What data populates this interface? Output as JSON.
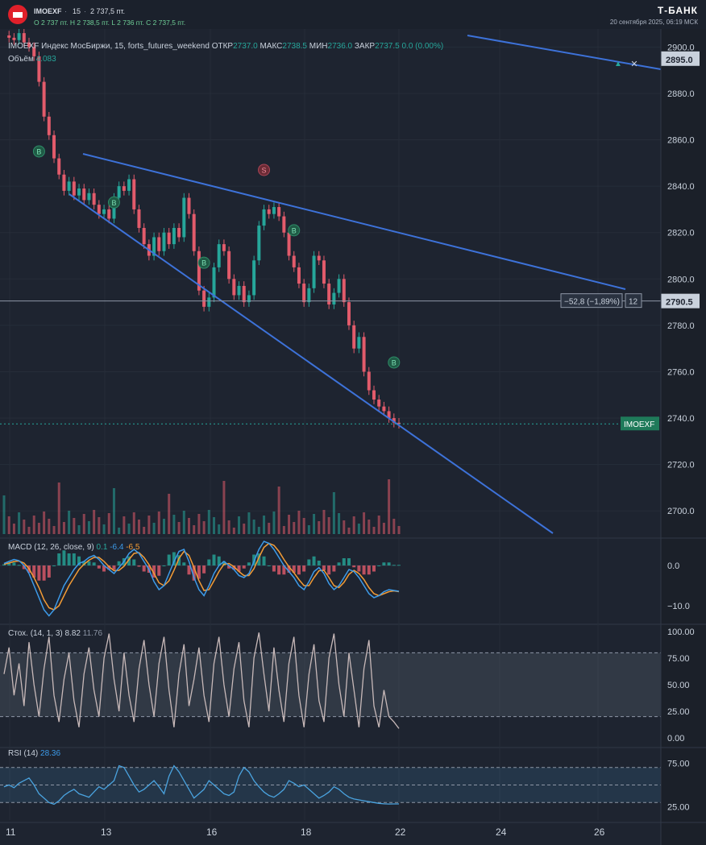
{
  "header": {
    "symbol": "IMOEXF",
    "sep": "·",
    "timeframe": "15",
    "sep2": "·",
    "last_price": "2 737,5 пт.",
    "ohlc": "O 2 737 пт.   H 2 738,5 пт.   L 2 736 пт.   C 2 737,5 пт.",
    "brand": "Т-БАНК",
    "datetime": "20 сентября 2025, 06:19 МСК"
  },
  "legend": {
    "symbol": "IMOEXF",
    "description": "Индекс МосБиржи, 15, forts_futures_weekend",
    "open_label": "ОТКР",
    "open": "2737.0",
    "high_label": "МАКС",
    "high": "2738.5",
    "low_label": "МИН",
    "low": "2736.0",
    "close_label": "ЗАКР",
    "close": "2737.5",
    "change": "0.0 (0.00%)",
    "volume_label": "Объём",
    "volume": "4.083"
  },
  "macd_legend": {
    "title": "MACD (12, 26, close, 9)",
    "hist": "0.1",
    "macd": "-6.4",
    "signal": "-6.5"
  },
  "stoch_legend": {
    "title": "Стох. (14, 1, 3)",
    "k": "8.82",
    "d": "11.76"
  },
  "rsi_legend": {
    "title": "RSI (14)",
    "value": "28.36"
  },
  "colors": {
    "up": "#26a69a",
    "down": "#e25b6b",
    "trendline": "#3d72d9",
    "macd": "#3d9be9",
    "signal": "#f39c36",
    "stoch": "#c8b9b9",
    "rsi": "#4aa3df"
  },
  "chart_data": [
    {
      "type": "candlestick",
      "name": "price",
      "ylim": [
        2690,
        2905
      ],
      "yticks": [
        "2900.0",
        "2880.0",
        "2860.0",
        "2840.0",
        "2820.0",
        "2800.0",
        "2780.0",
        "2760.0",
        "2740.0",
        "2720.0",
        "2700.0"
      ],
      "ytick_values": [
        2900,
        2880,
        2860,
        2840,
        2820,
        2800,
        2780,
        2760,
        2740,
        2720,
        2700
      ],
      "xticks": [
        "11",
        "13",
        "16",
        "18",
        "22",
        "24",
        "26"
      ],
      "path_points": [
        [
          0,
          2905
        ],
        [
          1,
          2904
        ],
        [
          2,
          2903
        ],
        [
          3,
          2906
        ],
        [
          4,
          2902
        ],
        [
          5,
          2900
        ],
        [
          6,
          2896
        ],
        [
          7,
          2885
        ],
        [
          8,
          2870
        ],
        [
          9,
          2862
        ],
        [
          10,
          2852
        ],
        [
          11,
          2845
        ],
        [
          12,
          2838
        ],
        [
          13,
          2842
        ],
        [
          14,
          2836
        ],
        [
          15,
          2839
        ],
        [
          16,
          2834
        ],
        [
          17,
          2837
        ],
        [
          18,
          2832
        ],
        [
          19,
          2828
        ],
        [
          20,
          2830
        ],
        [
          21,
          2826
        ],
        [
          22,
          2835
        ],
        [
          23,
          2840
        ],
        [
          24,
          2838
        ],
        [
          25,
          2843
        ],
        [
          26,
          2830
        ],
        [
          27,
          2822
        ],
        [
          28,
          2815
        ],
        [
          29,
          2810
        ],
        [
          30,
          2818
        ],
        [
          31,
          2812
        ],
        [
          32,
          2820
        ],
        [
          33,
          2815
        ],
        [
          34,
          2822
        ],
        [
          35,
          2818
        ],
        [
          36,
          2835
        ],
        [
          37,
          2828
        ],
        [
          38,
          2812
        ],
        [
          39,
          2795
        ],
        [
          40,
          2788
        ],
        [
          41,
          2792
        ],
        [
          42,
          2805
        ],
        [
          43,
          2815
        ],
        [
          44,
          2812
        ],
        [
          45,
          2800
        ],
        [
          46,
          2793
        ],
        [
          47,
          2797
        ],
        [
          48,
          2790
        ],
        [
          49,
          2793
        ],
        [
          50,
          2808
        ],
        [
          51,
          2823
        ],
        [
          52,
          2830
        ],
        [
          53,
          2828
        ],
        [
          54,
          2831
        ],
        [
          55,
          2827
        ],
        [
          56,
          2820
        ],
        [
          57,
          2810
        ],
        [
          58,
          2805
        ],
        [
          59,
          2798
        ],
        [
          60,
          2790
        ],
        [
          61,
          2796
        ],
        [
          62,
          2810
        ],
        [
          63,
          2808
        ],
        [
          64,
          2798
        ],
        [
          65,
          2789
        ],
        [
          66,
          2794
        ],
        [
          67,
          2800
        ],
        [
          68,
          2790
        ],
        [
          69,
          2780
        ],
        [
          70,
          2770
        ],
        [
          71,
          2775
        ],
        [
          72,
          2760
        ],
        [
          73,
          2752
        ],
        [
          74,
          2748
        ],
        [
          75,
          2745
        ],
        [
          76,
          2743
        ],
        [
          77,
          2740
        ],
        [
          78,
          2738
        ],
        [
          79,
          2737.5
        ]
      ],
      "trendlines": [
        {
          "points": [
            [
              2856,
              1
            ],
            [
              2796,
              2
            ]
          ]
        },
        {
          "points": [
            [
              2840,
              3
            ],
            [
              2687,
              4
            ]
          ]
        },
        {
          "points": [
            [
              2910,
              5
            ],
            [
              2894,
              6
            ]
          ]
        }
      ],
      "hline": {
        "value": 2790.5,
        "label": "2790.5",
        "measure": "−52,8 (−1,89%)",
        "bars": "12"
      },
      "last_label": "IMOEXF",
      "last_value": 2737.5,
      "top_label": "2895.0",
      "markers": [
        {
          "text": "B",
          "x": 7,
          "y": 2855
        },
        {
          "text": "B",
          "x": 22,
          "y": 2833
        },
        {
          "text": "S",
          "x": 52,
          "y": 2847
        },
        {
          "text": "B",
          "x": 40,
          "y": 2807
        },
        {
          "text": "B",
          "x": 58,
          "y": 2821
        },
        {
          "text": "B",
          "x": 78,
          "y": 2764
        }
      ]
    },
    {
      "type": "line",
      "name": "MACD",
      "ylim": [
        -14,
        6
      ],
      "yticks": [
        "0.0",
        "−10.0"
      ],
      "ytick_values": [
        0,
        -10
      ],
      "series": [
        {
          "name": "macd",
          "values": [
            0.5,
            1.0,
            1.5,
            1.2,
            0.0,
            -2.0,
            -5.0,
            -8.0,
            -11.0,
            -12.5,
            -11.0,
            -8.0,
            -5.0,
            -3.0,
            -1.0,
            0.5,
            1.0,
            2.0,
            2.5,
            1.5,
            0.0,
            -1.0,
            -2.0,
            -0.5,
            1.0,
            3.0,
            4.0,
            3.0,
            1.0,
            -1.0,
            -4.0,
            -6.0,
            -5.0,
            -2.0,
            1.0,
            3.5,
            4.0,
            1.0,
            -3.0,
            -6.0,
            -7.5,
            -5.0,
            -2.0,
            0.0,
            1.0,
            0.0,
            -1.0,
            -2.5,
            -3.0,
            -2.0,
            1.0,
            4.0,
            6.0,
            5.5,
            4.0,
            2.0,
            0.0,
            -1.5,
            -3.0,
            -5.0,
            -6.0,
            -4.0,
            -1.5,
            -0.5,
            -2.0,
            -4.5,
            -6.0,
            -5.0,
            -3.0,
            -1.0,
            -1.5,
            -3.0,
            -5.0,
            -7.0,
            -8.0,
            -7.5,
            -6.5,
            -6.0,
            -6.2,
            -6.4
          ]
        },
        {
          "name": "signal",
          "values": [
            0.3,
            0.6,
            1.0,
            1.1,
            0.6,
            -0.8,
            -3.0,
            -5.5,
            -8.5,
            -10.5,
            -11.0,
            -10.0,
            -7.5,
            -5.0,
            -3.0,
            -1.0,
            0.3,
            1.3,
            2.0,
            2.0,
            1.0,
            -0.3,
            -1.3,
            -1.2,
            -0.2,
            1.5,
            3.0,
            3.2,
            2.0,
            0.2,
            -2.0,
            -4.3,
            -5.0,
            -3.8,
            -1.2,
            1.8,
            3.5,
            2.5,
            -0.5,
            -3.8,
            -6.2,
            -6.0,
            -3.8,
            -1.5,
            0.3,
            0.5,
            -0.3,
            -1.5,
            -2.5,
            -2.5,
            -0.8,
            2.0,
            4.5,
            5.5,
            5.0,
            3.5,
            1.5,
            -0.3,
            -1.8,
            -3.5,
            -5.0,
            -5.0,
            -3.0,
            -1.3,
            -1.2,
            -3.0,
            -5.0,
            -5.5,
            -4.2,
            -2.2,
            -1.2,
            -2.0,
            -3.5,
            -5.5,
            -7.0,
            -7.5,
            -7.0,
            -6.5,
            -6.3,
            -6.5
          ]
        }
      ]
    },
    {
      "type": "line",
      "name": "Stoch",
      "ylim": [
        -5,
        105
      ],
      "yticks": [
        "100.00",
        "75.00",
        "50.00",
        "25.00",
        "0.00"
      ],
      "ytick_values": [
        100,
        75,
        50,
        25,
        0
      ],
      "band": [
        20,
        80
      ],
      "series": [
        {
          "name": "k",
          "values": [
            60,
            85,
            40,
            70,
            30,
            90,
            50,
            20,
            65,
            95,
            40,
            15,
            55,
            80,
            35,
            10,
            60,
            85,
            45,
            20,
            75,
            98,
            55,
            25,
            80,
            40,
            15,
            65,
            92,
            50,
            20,
            70,
            95,
            45,
            10,
            60,
            88,
            30,
            55,
            85,
            40,
            15,
            70,
            95,
            50,
            20,
            65,
            90,
            35,
            10,
            75,
            99,
            60,
            25,
            85,
            45,
            15,
            70,
            95,
            40,
            10,
            60,
            88,
            35,
            15,
            75,
            98,
            50,
            20,
            80,
            45,
            10,
            65,
            92,
            30,
            10,
            45,
            20,
            15,
            8.82
          ]
        }
      ]
    },
    {
      "type": "line",
      "name": "RSI",
      "ylim": [
        10,
        90
      ],
      "yticks": [
        "75.00",
        "25.00"
      ],
      "ytick_values": [
        75,
        25
      ],
      "band": [
        30,
        70
      ],
      "series": [
        {
          "name": "rsi",
          "values": [
            48,
            50,
            47,
            52,
            55,
            58,
            50,
            40,
            35,
            30,
            28,
            32,
            38,
            42,
            45,
            40,
            38,
            36,
            42,
            48,
            45,
            50,
            55,
            72,
            70,
            60,
            50,
            42,
            45,
            50,
            55,
            48,
            40,
            60,
            72,
            65,
            55,
            45,
            35,
            40,
            45,
            55,
            50,
            45,
            40,
            38,
            42,
            60,
            70,
            65,
            55,
            48,
            42,
            38,
            36,
            40,
            45,
            55,
            52,
            48,
            50,
            45,
            40,
            35,
            38,
            42,
            48,
            45,
            40,
            36,
            34,
            33,
            32,
            31,
            30,
            29,
            28.5,
            28.3,
            28.36,
            28.36
          ]
        }
      ]
    }
  ],
  "xaxis": {
    "ticks": [
      "11",
      "13",
      "16",
      "18",
      "22",
      "24",
      "26"
    ]
  }
}
